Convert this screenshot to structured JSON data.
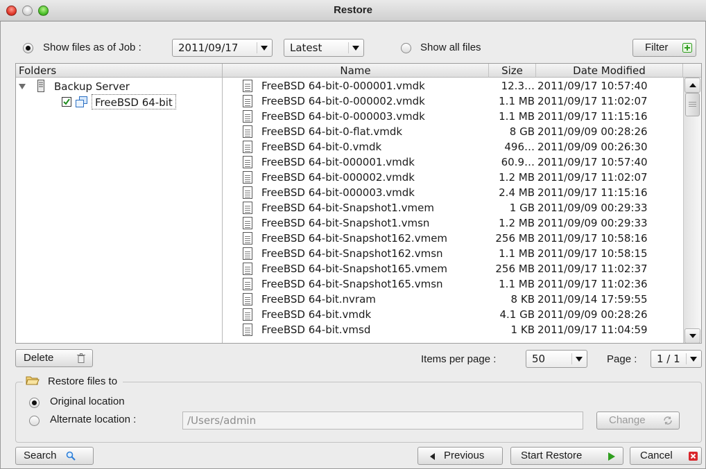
{
  "window": {
    "title": "Restore"
  },
  "toolbar": {
    "show_files_as_of_job_label": "Show files as of Job :",
    "job_date_value": "2011/09/17",
    "version_value": "Latest",
    "show_all_files_label": "Show all files",
    "filter_label": "Filter"
  },
  "folders": {
    "header": "Folders",
    "items": [
      {
        "label": "Backup Server",
        "level": 0,
        "expanded": true
      },
      {
        "label": "FreeBSD 64-bit",
        "level": 1,
        "checked": true,
        "selected": true
      }
    ]
  },
  "files": {
    "columns": [
      "Name",
      "Size",
      "Date Modified"
    ],
    "rows": [
      {
        "name": "FreeBSD 64-bit-0-000001.vmdk",
        "size": "12.3…",
        "date": "2011/09/17 10:57:40"
      },
      {
        "name": "FreeBSD 64-bit-0-000002.vmdk",
        "size": "1.1 MB",
        "date": "2011/09/17 11:02:07"
      },
      {
        "name": "FreeBSD 64-bit-0-000003.vmdk",
        "size": "1.1 MB",
        "date": "2011/09/17 11:15:16"
      },
      {
        "name": "FreeBSD 64-bit-0-flat.vmdk",
        "size": "8 GB",
        "date": "2011/09/09 00:28:26"
      },
      {
        "name": "FreeBSD 64-bit-0.vmdk",
        "size": "496…",
        "date": "2011/09/09 00:26:30"
      },
      {
        "name": "FreeBSD 64-bit-000001.vmdk",
        "size": "60.9…",
        "date": "2011/09/17 10:57:40"
      },
      {
        "name": "FreeBSD 64-bit-000002.vmdk",
        "size": "1.2 MB",
        "date": "2011/09/17 11:02:07"
      },
      {
        "name": "FreeBSD 64-bit-000003.vmdk",
        "size": "2.4 MB",
        "date": "2011/09/17 11:15:16"
      },
      {
        "name": "FreeBSD 64-bit-Snapshot1.vmem",
        "size": "1 GB",
        "date": "2011/09/09 00:29:33"
      },
      {
        "name": "FreeBSD 64-bit-Snapshot1.vmsn",
        "size": "1.2 MB",
        "date": "2011/09/09 00:29:33"
      },
      {
        "name": "FreeBSD 64-bit-Snapshot162.vmem",
        "size": "256 MB",
        "date": "2011/09/17 10:58:16"
      },
      {
        "name": "FreeBSD 64-bit-Snapshot162.vmsn",
        "size": "1.1 MB",
        "date": "2011/09/17 10:58:15"
      },
      {
        "name": "FreeBSD 64-bit-Snapshot165.vmem",
        "size": "256 MB",
        "date": "2011/09/17 11:02:37"
      },
      {
        "name": "FreeBSD 64-bit-Snapshot165.vmsn",
        "size": "1.1 MB",
        "date": "2011/09/17 11:02:36"
      },
      {
        "name": "FreeBSD 64-bit.nvram",
        "size": "8 KB",
        "date": "2011/09/14 17:59:55"
      },
      {
        "name": "FreeBSD 64-bit.vmdk",
        "size": "4.1 GB",
        "date": "2011/09/09 00:28:26"
      },
      {
        "name": "FreeBSD 64-bit.vmsd",
        "size": "1 KB",
        "date": "2011/09/17 11:04:59"
      }
    ]
  },
  "pagination": {
    "delete_label": "Delete",
    "items_per_page_label": "Items per page :",
    "items_per_page_value": "50",
    "page_label": "Page :",
    "page_value": "1 / 1"
  },
  "restore_to": {
    "legend": "Restore files to",
    "original_label": "Original location",
    "alternate_label": "Alternate location :",
    "alternate_path": "/Users/admin",
    "change_label": "Change"
  },
  "footer": {
    "search_label": "Search",
    "previous_label": "Previous",
    "start_restore_label": "Start Restore",
    "cancel_label": "Cancel"
  },
  "colors": {
    "accent_green": "#2f9e1f",
    "cancel_red": "#d9262b",
    "search_blue": "#2f7fd8"
  }
}
